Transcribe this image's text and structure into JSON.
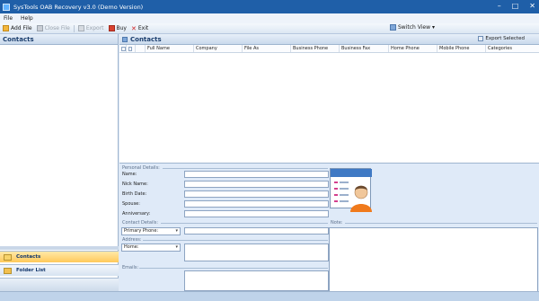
{
  "window": {
    "title": "SysTools OAB Recovery v3.0 (Demo Version)"
  },
  "menu": [
    "File",
    "Help"
  ],
  "toolbar": {
    "add_file": "Add File",
    "close_file": "Close File",
    "export": "Export",
    "buy": "Buy",
    "exit": "Exit",
    "switch_view": "Switch View"
  },
  "left_pane": {
    "header": "Contacts",
    "nav": {
      "contacts": "Contacts",
      "folder_list": "Folder List"
    }
  },
  "contacts_pane": {
    "header": "Contacts",
    "export_selected": "Export Selected",
    "columns": [
      "Full Name",
      "Company",
      "File As",
      "Business Phone",
      "Business Fax",
      "Home Phone",
      "Mobile Phone",
      "Categories"
    ]
  },
  "details": {
    "personal_details": "Personal Details:",
    "name": "Name:",
    "nick_name": "Nick Name:",
    "birth_date": "Birth Date:",
    "spouse": "Spouse:",
    "anniversary": "Anniversary:",
    "contact_details": "Contact Details:",
    "phone_type": "Primary Phone:",
    "address": "Address:",
    "address_type": "Home:",
    "emails": "Emails:",
    "note": "Note:"
  },
  "colors": {
    "title_bar": "#1f5fa8",
    "accent_nav": "#ffc95a",
    "panel_bg": "#dfeaf8"
  }
}
